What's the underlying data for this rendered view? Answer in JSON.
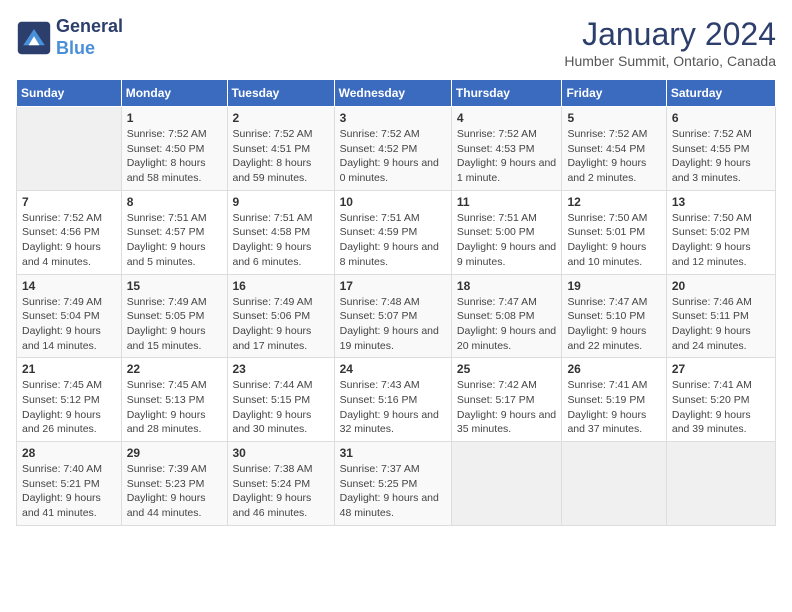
{
  "header": {
    "logo_line1": "General",
    "logo_line2": "Blue",
    "title": "January 2024",
    "subtitle": "Humber Summit, Ontario, Canada"
  },
  "days_of_week": [
    "Sunday",
    "Monday",
    "Tuesday",
    "Wednesday",
    "Thursday",
    "Friday",
    "Saturday"
  ],
  "weeks": [
    [
      {
        "day": "",
        "sunrise": "",
        "sunset": "",
        "daylight": "",
        "empty": true
      },
      {
        "day": "1",
        "sunrise": "Sunrise: 7:52 AM",
        "sunset": "Sunset: 4:50 PM",
        "daylight": "Daylight: 8 hours and 58 minutes."
      },
      {
        "day": "2",
        "sunrise": "Sunrise: 7:52 AM",
        "sunset": "Sunset: 4:51 PM",
        "daylight": "Daylight: 8 hours and 59 minutes."
      },
      {
        "day": "3",
        "sunrise": "Sunrise: 7:52 AM",
        "sunset": "Sunset: 4:52 PM",
        "daylight": "Daylight: 9 hours and 0 minutes."
      },
      {
        "day": "4",
        "sunrise": "Sunrise: 7:52 AM",
        "sunset": "Sunset: 4:53 PM",
        "daylight": "Daylight: 9 hours and 1 minute."
      },
      {
        "day": "5",
        "sunrise": "Sunrise: 7:52 AM",
        "sunset": "Sunset: 4:54 PM",
        "daylight": "Daylight: 9 hours and 2 minutes."
      },
      {
        "day": "6",
        "sunrise": "Sunrise: 7:52 AM",
        "sunset": "Sunset: 4:55 PM",
        "daylight": "Daylight: 9 hours and 3 minutes."
      }
    ],
    [
      {
        "day": "7",
        "sunrise": "Sunrise: 7:52 AM",
        "sunset": "Sunset: 4:56 PM",
        "daylight": "Daylight: 9 hours and 4 minutes."
      },
      {
        "day": "8",
        "sunrise": "Sunrise: 7:51 AM",
        "sunset": "Sunset: 4:57 PM",
        "daylight": "Daylight: 9 hours and 5 minutes."
      },
      {
        "day": "9",
        "sunrise": "Sunrise: 7:51 AM",
        "sunset": "Sunset: 4:58 PM",
        "daylight": "Daylight: 9 hours and 6 minutes."
      },
      {
        "day": "10",
        "sunrise": "Sunrise: 7:51 AM",
        "sunset": "Sunset: 4:59 PM",
        "daylight": "Daylight: 9 hours and 8 minutes."
      },
      {
        "day": "11",
        "sunrise": "Sunrise: 7:51 AM",
        "sunset": "Sunset: 5:00 PM",
        "daylight": "Daylight: 9 hours and 9 minutes."
      },
      {
        "day": "12",
        "sunrise": "Sunrise: 7:50 AM",
        "sunset": "Sunset: 5:01 PM",
        "daylight": "Daylight: 9 hours and 10 minutes."
      },
      {
        "day": "13",
        "sunrise": "Sunrise: 7:50 AM",
        "sunset": "Sunset: 5:02 PM",
        "daylight": "Daylight: 9 hours and 12 minutes."
      }
    ],
    [
      {
        "day": "14",
        "sunrise": "Sunrise: 7:49 AM",
        "sunset": "Sunset: 5:04 PM",
        "daylight": "Daylight: 9 hours and 14 minutes."
      },
      {
        "day": "15",
        "sunrise": "Sunrise: 7:49 AM",
        "sunset": "Sunset: 5:05 PM",
        "daylight": "Daylight: 9 hours and 15 minutes."
      },
      {
        "day": "16",
        "sunrise": "Sunrise: 7:49 AM",
        "sunset": "Sunset: 5:06 PM",
        "daylight": "Daylight: 9 hours and 17 minutes."
      },
      {
        "day": "17",
        "sunrise": "Sunrise: 7:48 AM",
        "sunset": "Sunset: 5:07 PM",
        "daylight": "Daylight: 9 hours and 19 minutes."
      },
      {
        "day": "18",
        "sunrise": "Sunrise: 7:47 AM",
        "sunset": "Sunset: 5:08 PM",
        "daylight": "Daylight: 9 hours and 20 minutes."
      },
      {
        "day": "19",
        "sunrise": "Sunrise: 7:47 AM",
        "sunset": "Sunset: 5:10 PM",
        "daylight": "Daylight: 9 hours and 22 minutes."
      },
      {
        "day": "20",
        "sunrise": "Sunrise: 7:46 AM",
        "sunset": "Sunset: 5:11 PM",
        "daylight": "Daylight: 9 hours and 24 minutes."
      }
    ],
    [
      {
        "day": "21",
        "sunrise": "Sunrise: 7:45 AM",
        "sunset": "Sunset: 5:12 PM",
        "daylight": "Daylight: 9 hours and 26 minutes."
      },
      {
        "day": "22",
        "sunrise": "Sunrise: 7:45 AM",
        "sunset": "Sunset: 5:13 PM",
        "daylight": "Daylight: 9 hours and 28 minutes."
      },
      {
        "day": "23",
        "sunrise": "Sunrise: 7:44 AM",
        "sunset": "Sunset: 5:15 PM",
        "daylight": "Daylight: 9 hours and 30 minutes."
      },
      {
        "day": "24",
        "sunrise": "Sunrise: 7:43 AM",
        "sunset": "Sunset: 5:16 PM",
        "daylight": "Daylight: 9 hours and 32 minutes."
      },
      {
        "day": "25",
        "sunrise": "Sunrise: 7:42 AM",
        "sunset": "Sunset: 5:17 PM",
        "daylight": "Daylight: 9 hours and 35 minutes."
      },
      {
        "day": "26",
        "sunrise": "Sunrise: 7:41 AM",
        "sunset": "Sunset: 5:19 PM",
        "daylight": "Daylight: 9 hours and 37 minutes."
      },
      {
        "day": "27",
        "sunrise": "Sunrise: 7:41 AM",
        "sunset": "Sunset: 5:20 PM",
        "daylight": "Daylight: 9 hours and 39 minutes."
      }
    ],
    [
      {
        "day": "28",
        "sunrise": "Sunrise: 7:40 AM",
        "sunset": "Sunset: 5:21 PM",
        "daylight": "Daylight: 9 hours and 41 minutes."
      },
      {
        "day": "29",
        "sunrise": "Sunrise: 7:39 AM",
        "sunset": "Sunset: 5:23 PM",
        "daylight": "Daylight: 9 hours and 44 minutes."
      },
      {
        "day": "30",
        "sunrise": "Sunrise: 7:38 AM",
        "sunset": "Sunset: 5:24 PM",
        "daylight": "Daylight: 9 hours and 46 minutes."
      },
      {
        "day": "31",
        "sunrise": "Sunrise: 7:37 AM",
        "sunset": "Sunset: 5:25 PM",
        "daylight": "Daylight: 9 hours and 48 minutes."
      },
      {
        "day": "",
        "sunrise": "",
        "sunset": "",
        "daylight": "",
        "empty": true
      },
      {
        "day": "",
        "sunrise": "",
        "sunset": "",
        "daylight": "",
        "empty": true
      },
      {
        "day": "",
        "sunrise": "",
        "sunset": "",
        "daylight": "",
        "empty": true
      }
    ]
  ]
}
